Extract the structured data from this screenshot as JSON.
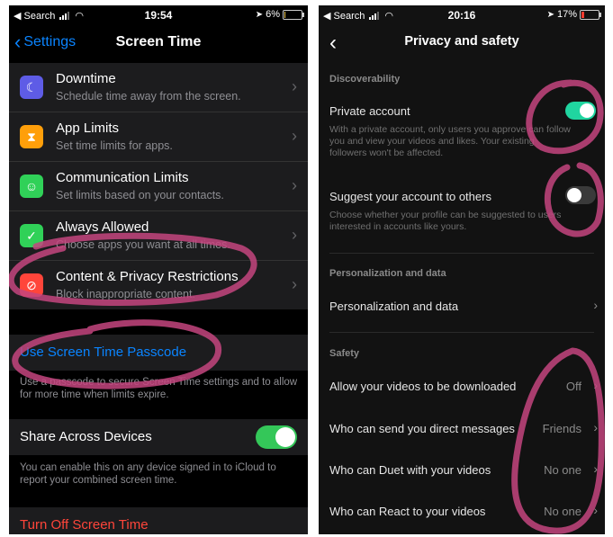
{
  "left": {
    "status": {
      "back_app": "◀ Search",
      "time": "19:54",
      "battery": "6%",
      "battery_level": 0.06
    },
    "nav": {
      "back": "Settings",
      "title": "Screen Time"
    },
    "rows": [
      {
        "title": "Downtime",
        "subtitle": "Schedule time away from the screen.",
        "icon": "moon-icon",
        "color": "#5e5ce6"
      },
      {
        "title": "App Limits",
        "subtitle": "Set time limits for apps.",
        "icon": "hourglass-icon",
        "color": "#ff9f0a"
      },
      {
        "title": "Communication Limits",
        "subtitle": "Set limits based on your contacts.",
        "icon": "person-icon",
        "color": "#30d158"
      },
      {
        "title": "Always Allowed",
        "subtitle": "Choose apps you want at all times.",
        "icon": "checkmark-icon",
        "color": "#30d158"
      },
      {
        "title": "Content & Privacy Restrictions",
        "subtitle": "Block inappropriate content.",
        "icon": "prohibited-icon",
        "color": "#ff453a"
      }
    ],
    "passcode": {
      "label": "Use Screen Time Passcode",
      "note": "Use a passcode to secure Screen Time settings and to allow for more time when limits expire."
    },
    "share": {
      "label": "Share Across Devices",
      "on": true,
      "note": "You can enable this on any device signed in to iCloud to report your combined screen time."
    },
    "turn_off": {
      "label": "Turn Off Screen Time"
    }
  },
  "right": {
    "status": {
      "back_app": "◀ Search",
      "time": "20:16",
      "battery": "17%",
      "battery_level": 0.17
    },
    "nav": {
      "title": "Privacy and safety"
    },
    "discoverability": {
      "header": "Discoverability",
      "private_account": {
        "label": "Private account",
        "on": true,
        "desc": "With a private account, only users you approve can follow you and view your videos and likes. Your existing followers won't be affected."
      },
      "suggest": {
        "label": "Suggest your account to others",
        "on": false,
        "desc": "Choose whether your profile can be suggested to users interested in accounts like yours."
      }
    },
    "personalization": {
      "header": "Personalization and data",
      "item": "Personalization and data"
    },
    "safety": {
      "header": "Safety",
      "items": [
        {
          "label": "Allow your videos to be downloaded",
          "value": "Off"
        },
        {
          "label": "Who can send you direct messages",
          "value": "Friends"
        },
        {
          "label": "Who can Duet with your videos",
          "value": "No one"
        },
        {
          "label": "Who can React to your videos",
          "value": "No one"
        }
      ]
    }
  },
  "annotation_color": "#c4457f"
}
